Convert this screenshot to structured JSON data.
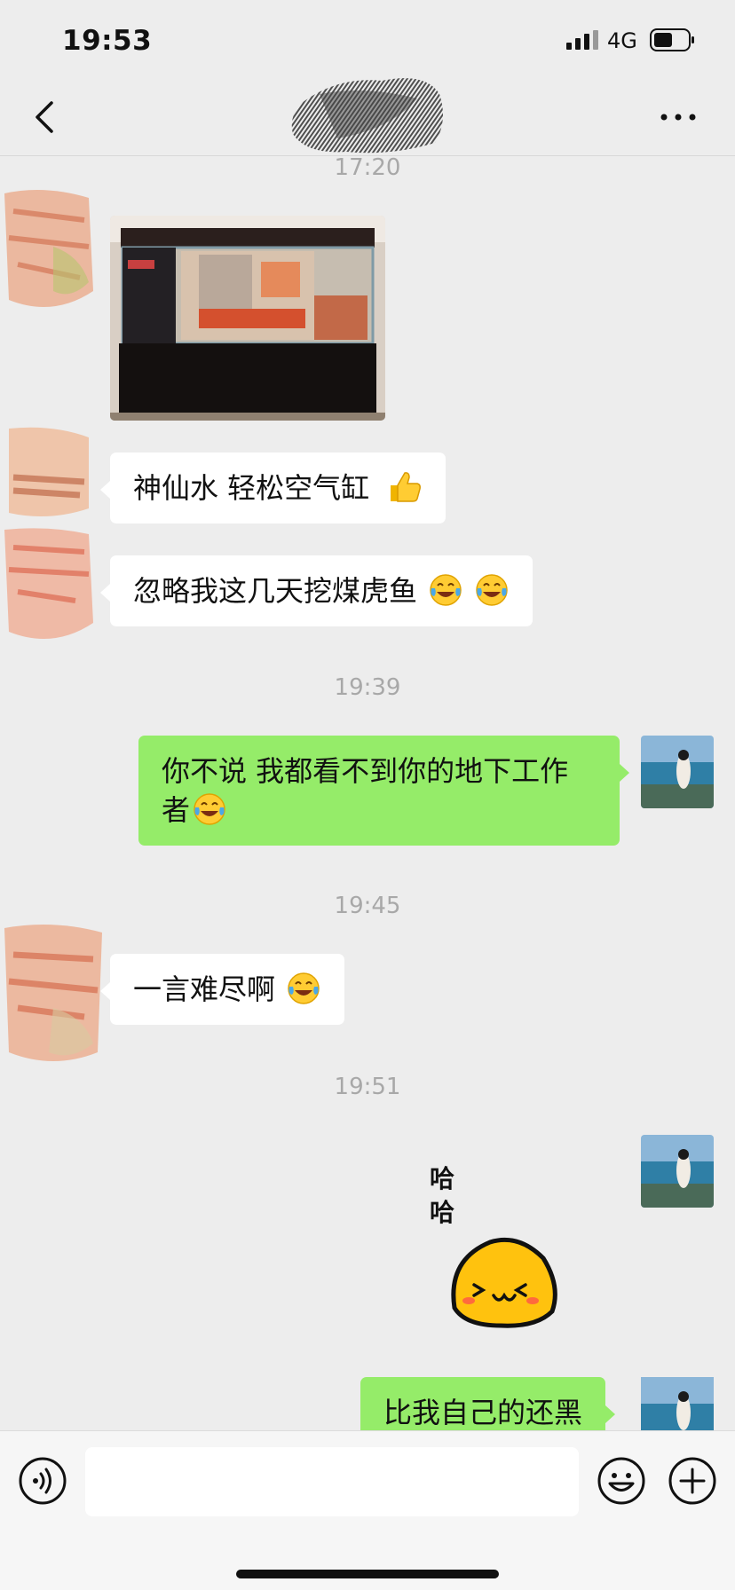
{
  "status_bar": {
    "time": "19:53",
    "network": "4G",
    "signal_icon": "signal-bars-icon",
    "battery_icon": "battery-icon",
    "battery_level": 0.5
  },
  "nav": {
    "back_icon": "chevron-left-icon",
    "more_icon": "more-dots-icon"
  },
  "messages": {
    "ts_1": "17:20",
    "msg_1_image": "photo-fish-tank",
    "msg_2": "神仙水 轻松空气缸",
    "msg_2_emoji": "thumbs-up-emoji",
    "msg_3": "忽略我这几天挖煤虎鱼",
    "msg_3_emoji": "tears-of-joy-emoji",
    "ts_2": "19:39",
    "msg_4_line1": "你不说 我都看不到你的地下工作",
    "msg_4_line2": "者",
    "ts_3": "19:45",
    "msg_5": "一言难尽啊",
    "ts_4": "19:51",
    "sticker_text": "哈\n哈",
    "sticker_icon": "laughing-blob-sticker",
    "msg_6": "比我自己的还黑"
  },
  "input_bar": {
    "voice_icon": "voice-icon",
    "emoji_icon": "emoji-icon",
    "plus_icon": "plus-icon",
    "value": ""
  },
  "colors": {
    "background": "#ededed",
    "outgoing_bubble": "#95ec69",
    "incoming_bubble": "#ffffff",
    "timestamp": "#a8a8a8"
  }
}
